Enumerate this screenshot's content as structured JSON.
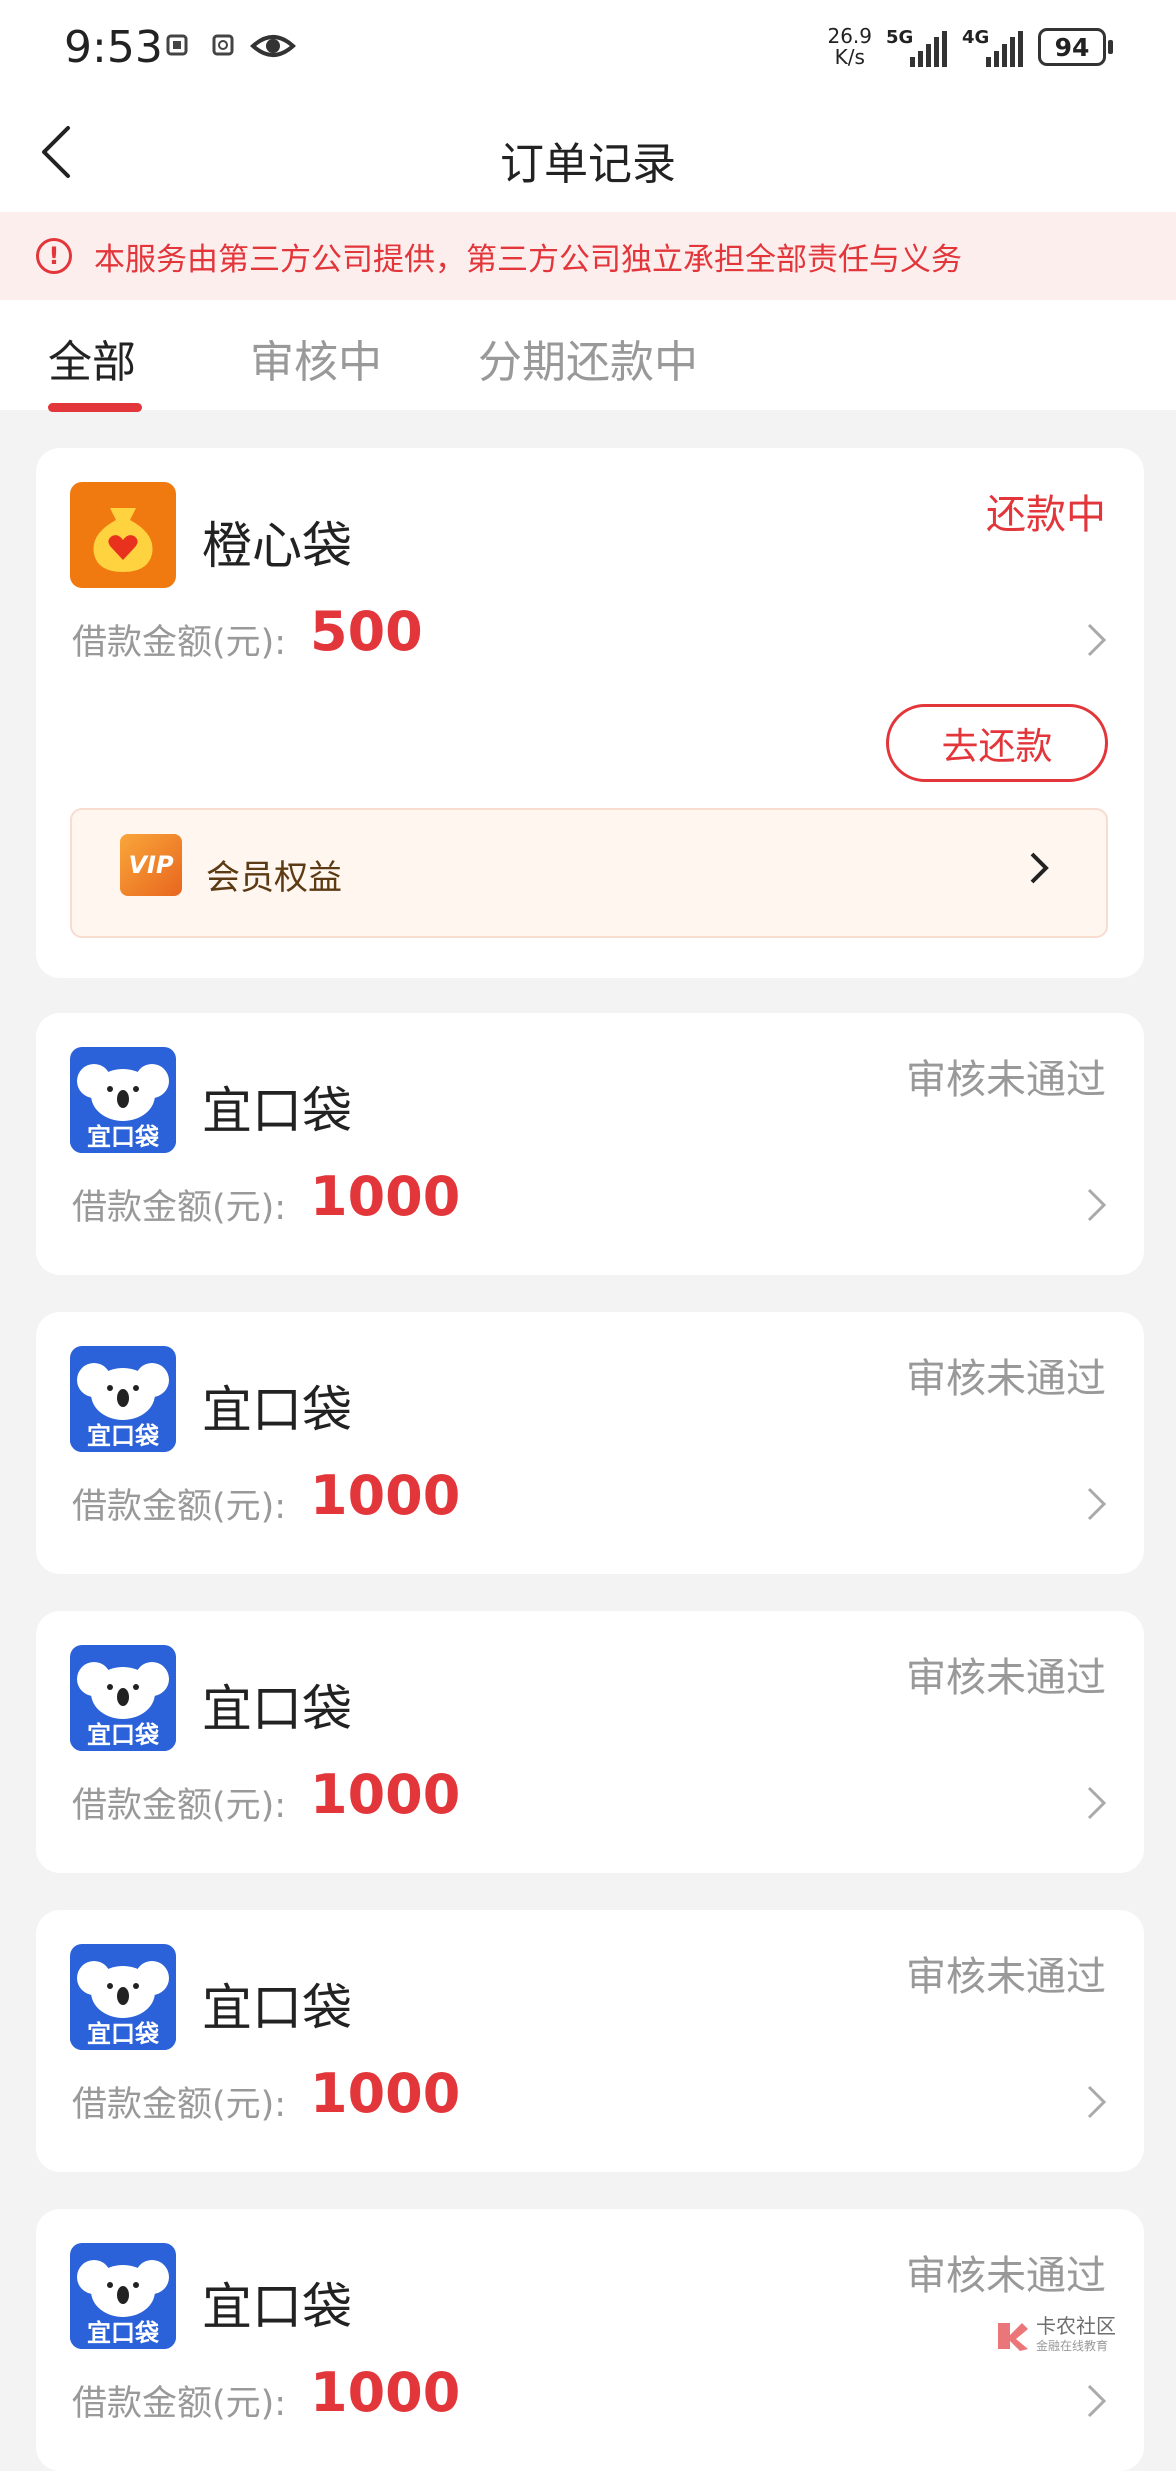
{
  "status_bar": {
    "time": "9:53",
    "net_speed_value": "26.9",
    "net_speed_unit": "K/s",
    "sim1": "5G",
    "sim2": "4G",
    "battery": "94"
  },
  "nav": {
    "title": "订单记录"
  },
  "notice": {
    "text": "本服务由第三方公司提供，第三方公司独立承担全部责任与义务"
  },
  "tabs": [
    {
      "label": "全部",
      "active": true
    },
    {
      "label": "审核中",
      "active": false
    },
    {
      "label": "分期还款中",
      "active": false
    }
  ],
  "orders": [
    {
      "name": "橙心袋",
      "status": "还款中",
      "amount_label": "借款金额(元):",
      "amount": "500",
      "action": "去还款",
      "vip_label": "会员权益",
      "vip_badge": "VIP"
    },
    {
      "name": "宜口袋",
      "status": "审核未通过",
      "amount_label": "借款金额(元):",
      "amount": "1000",
      "logo_text": "宜口袋"
    },
    {
      "name": "宜口袋",
      "status": "审核未通过",
      "amount_label": "借款金额(元):",
      "amount": "1000",
      "logo_text": "宜口袋"
    },
    {
      "name": "宜口袋",
      "status": "审核未通过",
      "amount_label": "借款金额(元):",
      "amount": "1000",
      "logo_text": "宜口袋"
    },
    {
      "name": "宜口袋",
      "status": "审核未通过",
      "amount_label": "借款金额(元):",
      "amount": "1000",
      "logo_text": "宜口袋"
    },
    {
      "name": "宜口袋",
      "status": "审核未通过",
      "amount_label": "借款金额(元):",
      "amount": "1000",
      "logo_text": "宜口袋"
    }
  ],
  "watermark": {
    "title": "卡农社区",
    "subtitle": "金融在线教育"
  },
  "colors": {
    "accent": "#e2363b",
    "muted": "#999999",
    "background": "#f3f3f3",
    "logo_blue": "#2b61d9",
    "logo_orange": "#f07a10"
  }
}
